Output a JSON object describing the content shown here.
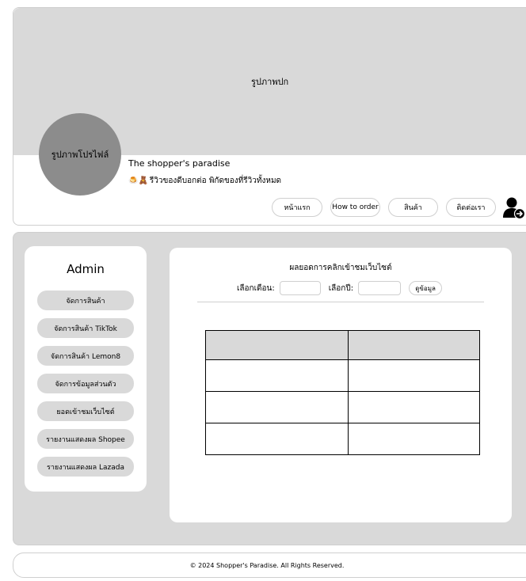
{
  "header": {
    "cover_label": "รูปภาพปก",
    "avatar_label": "รูปภาพโปรไฟล์",
    "shop_name": "The shopper's paradise",
    "shop_emoji": "🍮🧸",
    "shop_description": "รีวิวของดีบอกต่อ พิกัดของที่รีวิวทั้งหมด"
  },
  "nav": {
    "items": [
      {
        "label": "หน้าแรก"
      },
      {
        "label": "How to order"
      },
      {
        "label": "สินค้า"
      },
      {
        "label": "ติดต่อเรา"
      }
    ],
    "user_icon": "user-logout-icon"
  },
  "sidebar": {
    "title": "Admin",
    "items": [
      {
        "label": "จัดการสินค้า"
      },
      {
        "label": "จัดการสินค้า TikTok"
      },
      {
        "label": "จัดการสินค้า Lemon8"
      },
      {
        "label": "จัดการข้อมูลส่วนตัว"
      },
      {
        "label": "ยอดเข้าชมเว็บไซต์"
      },
      {
        "label": "รายงานแสดงผล Shopee"
      },
      {
        "label": "รายงานแสดงผล Lazada"
      }
    ]
  },
  "content": {
    "title": "ผลยอดการคลิกเข้าชมเว็บไซต์",
    "month_label": "เลือกเดือน:",
    "month_value": "",
    "year_label": "เลือกปี:",
    "year_value": "",
    "view_button": "ดูข้อมูล",
    "table": {
      "headers": [
        "",
        ""
      ],
      "rows": [
        [
          "",
          ""
        ],
        [
          "",
          ""
        ],
        [
          "",
          ""
        ]
      ]
    }
  },
  "footer": {
    "text": "© 2024 Shopper's Paradise. All Rights Reserved."
  },
  "colors": {
    "panel_gray": "#d9d9d9",
    "avatar_gray": "#8c8c8c",
    "border": "#cfcfcf"
  }
}
